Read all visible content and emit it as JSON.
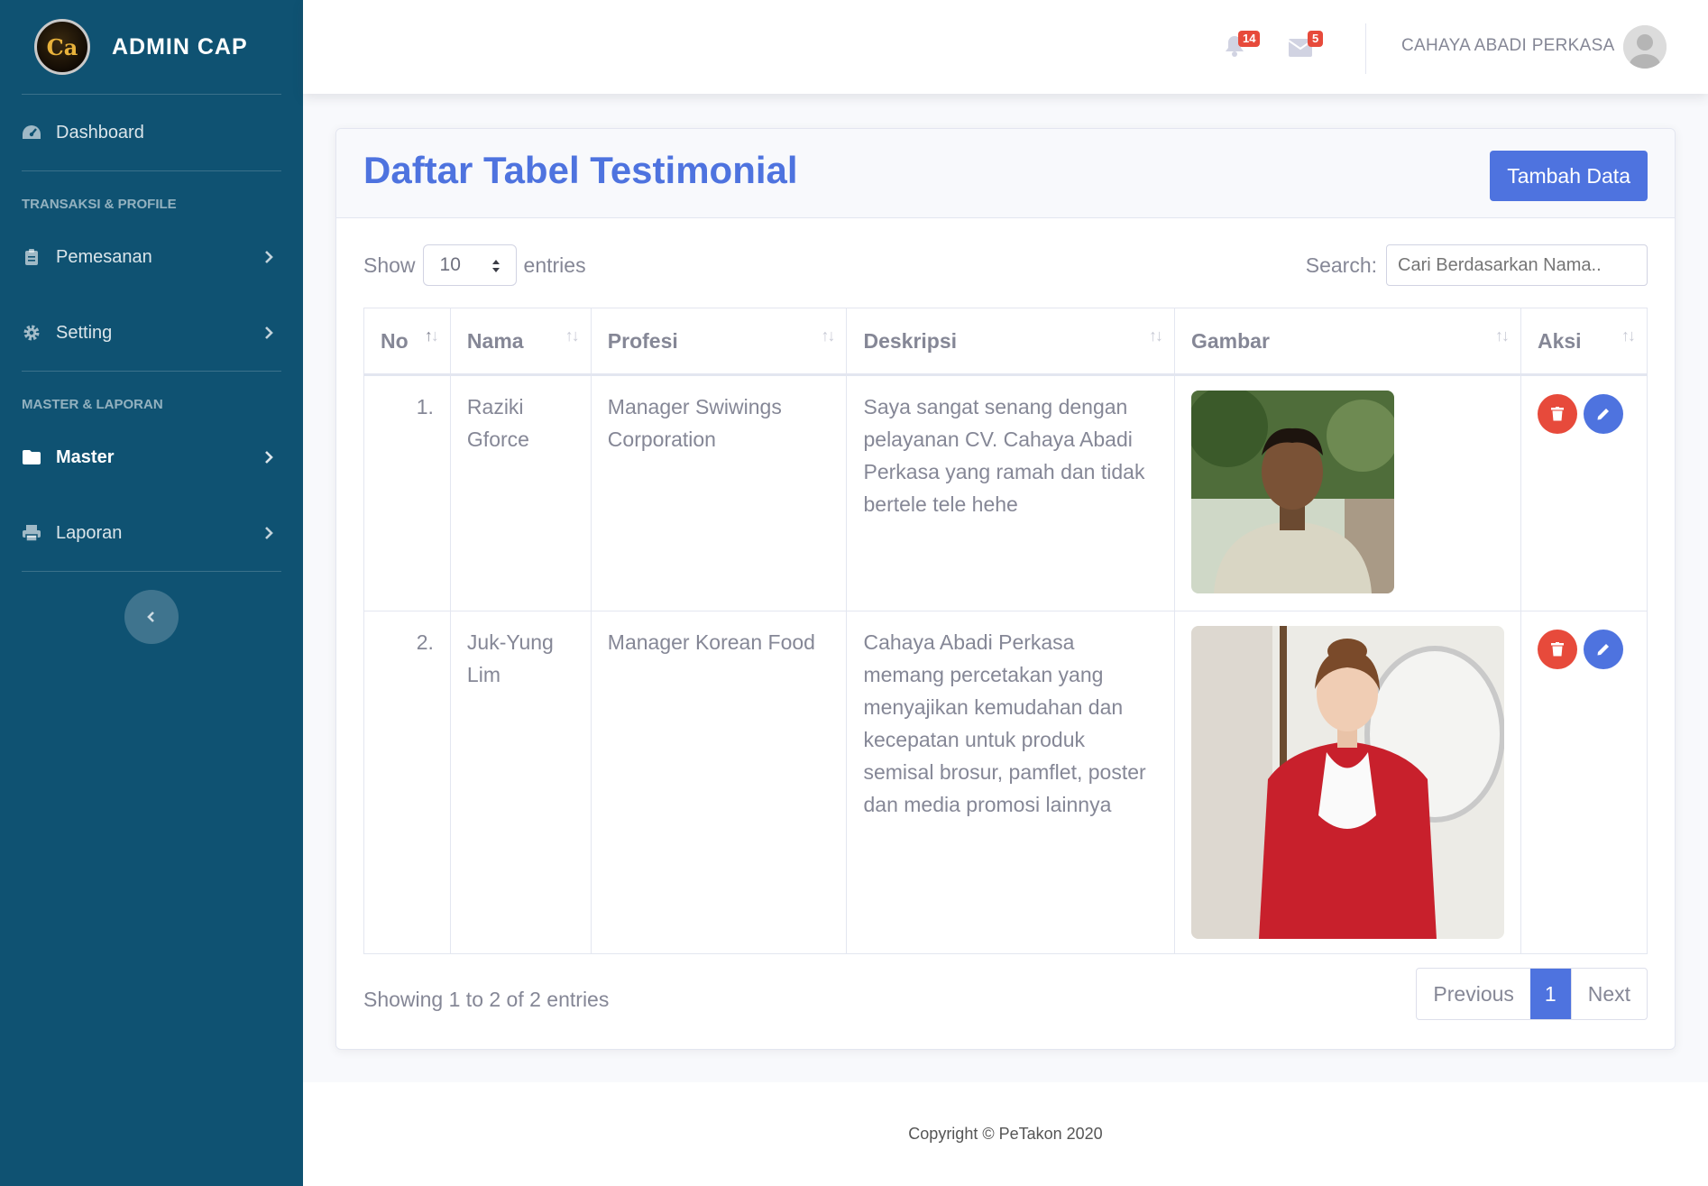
{
  "sidebar": {
    "brand": "ADMIN CAP",
    "logo_text": "Ca",
    "items": {
      "dashboard": "Dashboard",
      "heading1": "TRANSAKSI & PROFILE",
      "pemesanan": "Pemesanan",
      "setting": "Setting",
      "heading2": "MASTER & LAPORAN",
      "master": "Master",
      "laporan": "Laporan"
    }
  },
  "topbar": {
    "alerts_count": "14",
    "messages_count": "5",
    "user_name": "CAHAYA ABADI PERKASA"
  },
  "card": {
    "title": "Daftar Tabel Testimonial",
    "add_button": "Tambah Data",
    "show_label": "Show",
    "entries_label": "entries",
    "page_length": "10",
    "search_label": "Search:",
    "search_placeholder": "Cari Berdasarkan Nama.."
  },
  "table": {
    "headers": [
      "No",
      "Nama",
      "Profesi",
      "Deskripsi",
      "Gambar",
      "Aksi"
    ],
    "rows": [
      {
        "no": "1.",
        "nama": "Raziki Gforce",
        "profesi": "Manager Swiwings Corporation",
        "deskripsi": "Saya sangat senang dengan pelayanan CV. Cahaya Abadi Perkasa yang ramah dan tidak bertele tele hehe"
      },
      {
        "no": "2.",
        "nama": "Juk-Yung Lim",
        "profesi": "Manager Korean Food",
        "deskripsi": "Cahaya Abadi Perkasa memang percetakan yang menyajikan kemudahan dan kecepatan untuk produk semisal brosur, pamflet, poster dan media promosi lainnya"
      }
    ]
  },
  "pagination": {
    "info": "Showing 1 to 2 of 2 entries",
    "previous": "Previous",
    "current": "1",
    "next": "Next"
  },
  "footer": {
    "copyright": "Copyright © PeTakon 2020"
  },
  "colors": {
    "sidebar": "#0f5272",
    "primary": "#4e73df",
    "danger": "#e74a3b"
  }
}
